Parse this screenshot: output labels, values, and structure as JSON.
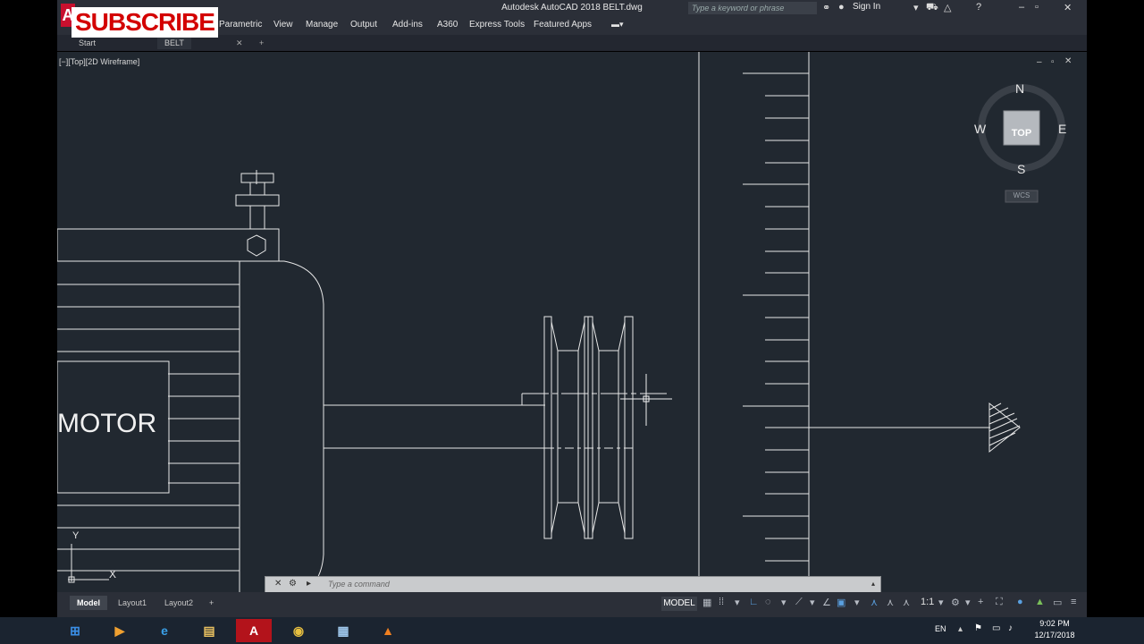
{
  "window": {
    "title": "Autodesk AutoCAD 2018    BELT.dwg",
    "search_placeholder": "Type a keyword or phrase",
    "sign_in": "Sign In"
  },
  "overlay": {
    "subscribe": "SUBSCRIBE",
    "logo_letter": "A"
  },
  "ribbon": {
    "tabs": [
      "Parametric",
      "View",
      "Manage",
      "Output",
      "Add-ins",
      "A360",
      "Express Tools",
      "Featured Apps"
    ]
  },
  "file_tabs": [
    "Start",
    "BELT"
  ],
  "viewport": {
    "label": "[−][Top][2D Wireframe]",
    "motor_label": "MOTOR",
    "viewcube": {
      "top": "TOP",
      "n": "N",
      "s": "S",
      "e": "E",
      "w": "W",
      "wcs": "WCS"
    },
    "ucs": {
      "x": "X",
      "y": "Y"
    }
  },
  "command_line": {
    "placeholder": "Type a command"
  },
  "layout_tabs": [
    "Model",
    "Layout1",
    "Layout2"
  ],
  "status": {
    "model": "MODEL",
    "scale": "1:1"
  },
  "taskbar": {
    "language": "EN",
    "time": "9:02 PM",
    "date": "12/17/2018"
  }
}
